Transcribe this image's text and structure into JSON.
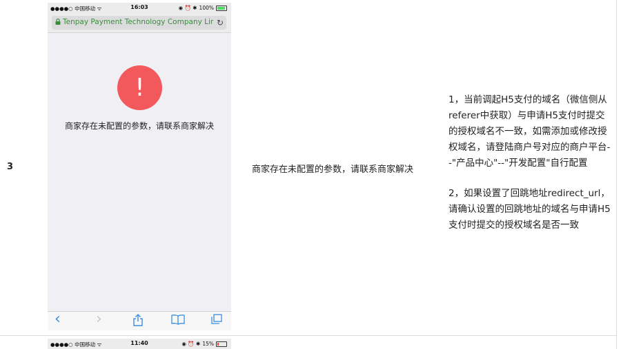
{
  "row": {
    "number": "3"
  },
  "phone1": {
    "status": {
      "carrier": "●●●●○ 中国移动 ᯤ",
      "time": "16:03",
      "icons": "◉ ⏰ ✱",
      "battery_pct": "100%"
    },
    "url": "Tenpay Payment Technology Company Limited",
    "error_symbol": "!",
    "error_message": "商家存在未配置的参数，请联系商家解决",
    "toolbar": {
      "back": "‹",
      "forward": "›",
      "share": "⇪",
      "bookmarks": "📖",
      "tabs": "⧉"
    }
  },
  "description": "商家存在未配置的参数，请联系商家解决",
  "notes": {
    "item1": "1，当前调起H5支付的域名（微信侧从referer中获取）与申请H5支付时提交的授权域名不一致，如需添加或修改授权域名，请登陆商户号对应的商户平台--\"产品中心\"--\"开发配置\"自行配置",
    "item2": "2，如果设置了回跳地址redirect_url，请确认设置的回跳地址的域名与申请H5支付时提交的授权域名是否一致"
  },
  "phone2": {
    "status": {
      "carrier": "●●●●○ 中国移动 ᯤ",
      "time": "11:40",
      "icons": "◉ ⏰ ✱",
      "battery_pct": "15%"
    }
  },
  "colors": {
    "alert": "#f2585c",
    "secure_url": "#3a8d3a",
    "toolbar_icon": "#3b8de0"
  }
}
